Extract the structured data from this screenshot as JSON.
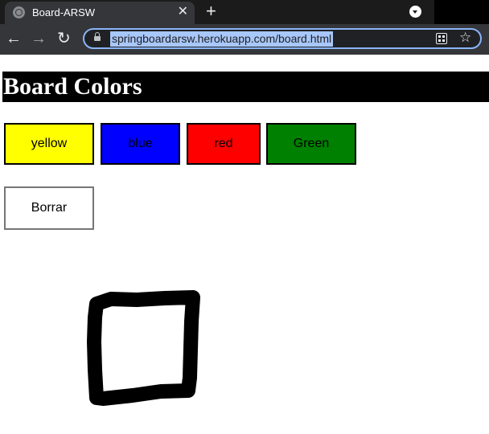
{
  "browser": {
    "tab_title": "Board-ARSW",
    "tab_close": "✕",
    "new_tab": "+",
    "url": "springboardarsw.herokuapp.com/board.html",
    "nav": {
      "back": "←",
      "forward": "→",
      "reload": "↻"
    },
    "star": "☆"
  },
  "page": {
    "heading": "Board Colors",
    "colors": [
      {
        "label": "yellow",
        "color": "#ffff00"
      },
      {
        "label": "blue",
        "color": "#0000ff"
      },
      {
        "label": "red",
        "color": "#ff0000"
      },
      {
        "label": "Green",
        "color": "#008000"
      }
    ],
    "clear_button": "Borrar"
  },
  "icons": [
    "globe-icon",
    "close-icon",
    "plus-icon",
    "tab-search-icon",
    "back-arrow-icon",
    "forward-arrow-icon",
    "reload-icon",
    "lock-icon",
    "apps-icon",
    "star-icon"
  ]
}
